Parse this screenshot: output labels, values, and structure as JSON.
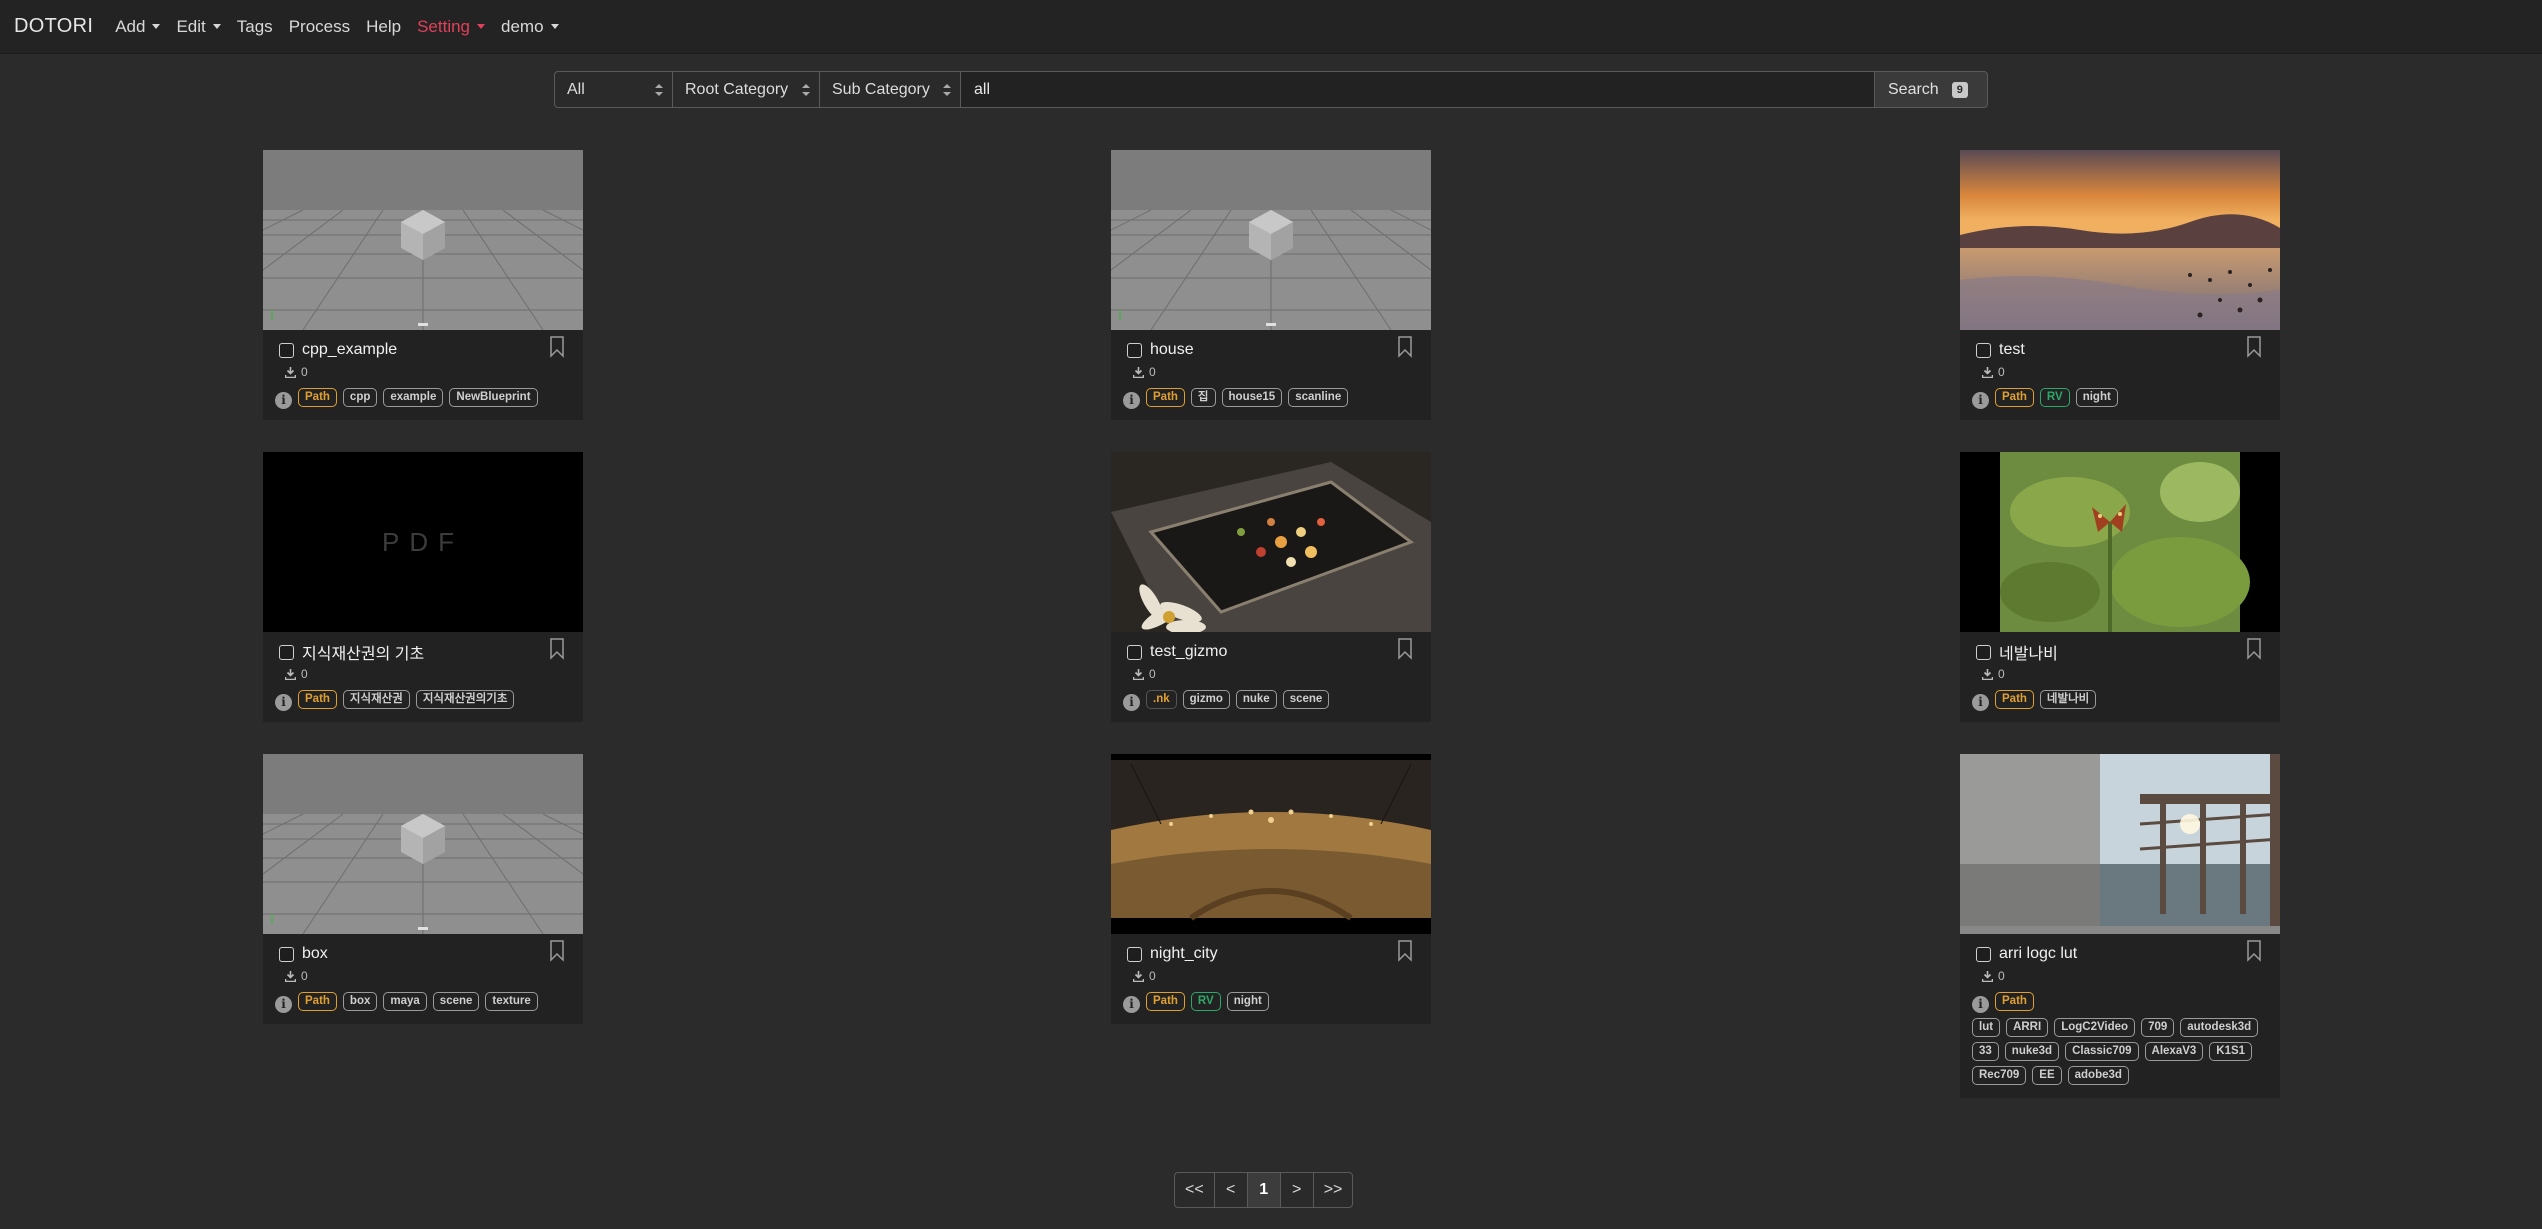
{
  "nav": {
    "brand": "DOTORI",
    "items": [
      {
        "label": "Add",
        "dropdown": true,
        "active": false
      },
      {
        "label": "Edit",
        "dropdown": true,
        "active": false
      },
      {
        "label": "Tags",
        "dropdown": false,
        "active": false
      },
      {
        "label": "Process",
        "dropdown": false,
        "active": false
      },
      {
        "label": "Help",
        "dropdown": false,
        "active": false
      },
      {
        "label": "Setting",
        "dropdown": true,
        "active": true
      },
      {
        "label": "demo",
        "dropdown": true,
        "active": false
      }
    ]
  },
  "search": {
    "type_select": "All",
    "root_category": "Root Category",
    "sub_category": "Sub Category",
    "query": "all",
    "button_label": "Search",
    "result_count": "9"
  },
  "cards": [
    {
      "title": "cpp_example",
      "downloads": "0",
      "thumb": "maya",
      "tags": [
        "Path",
        "cpp",
        "example",
        "NewBlueprint"
      ]
    },
    {
      "title": "house",
      "downloads": "0",
      "thumb": "maya",
      "tags": [
        "Path",
        "집",
        "house15",
        "scanline"
      ]
    },
    {
      "title": "test",
      "downloads": "0",
      "thumb": "sunset",
      "tags": [
        "Path",
        "RV",
        "night"
      ]
    },
    {
      "title": "지식재산권의 기초",
      "downloads": "0",
      "thumb": "pdf",
      "tags": [
        "Path",
        "지식재산권",
        "지식재산권의기초"
      ]
    },
    {
      "title": "test_gizmo",
      "downloads": "0",
      "thumb": "tray",
      "tags": [
        ".nk",
        "gizmo",
        "nuke",
        "scene"
      ]
    },
    {
      "title": "네발나비",
      "downloads": "0",
      "thumb": "butterfly",
      "tags": [
        "Path",
        "네발나비"
      ]
    },
    {
      "title": "box",
      "downloads": "0",
      "thumb": "maya",
      "tags": [
        "Path",
        "box",
        "maya",
        "scene",
        "texture"
      ]
    },
    {
      "title": "night_city",
      "downloads": "0",
      "thumb": "city",
      "tags": [
        "Path",
        "RV",
        "night"
      ]
    },
    {
      "title": "arri logc lut",
      "downloads": "0",
      "thumb": "pier",
      "tags": [
        "Path"
      ],
      "extra_tags": [
        "lut",
        "ARRI",
        "LogC2Video",
        "709",
        "autodesk3d",
        "33",
        "nuke3d",
        "Classic709",
        "AlexaV3",
        "K1S1",
        "Rec709",
        "EE",
        "adobe3d"
      ]
    }
  ],
  "pdf_label": "PDF",
  "pagination": [
    "<<",
    "<",
    "1",
    ">",
    ">>"
  ],
  "current_page": "1",
  "colors": {
    "accent": "#e0405a",
    "path_tag": "#e0a030",
    "rv_tag": "#2ea86a"
  }
}
